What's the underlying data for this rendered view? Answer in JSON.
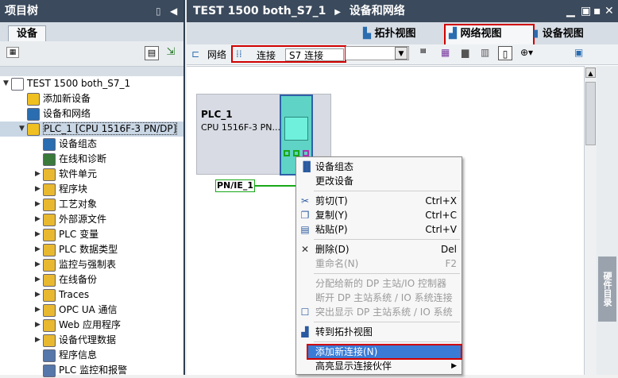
{
  "left_panel": {
    "title": "项目树",
    "tab": "设备",
    "tree": [
      {
        "label": "TEST 1500 both_S7_1",
        "indent": 0,
        "expanded": true,
        "icon": "project-icon"
      },
      {
        "label": "添加新设备",
        "indent": 1,
        "icon": "add-device-icon"
      },
      {
        "label": "设备和网络",
        "indent": 1,
        "icon": "network-icon"
      },
      {
        "label": "PLC_1 [CPU 1516F-3 PN/DP]",
        "indent": 1,
        "expanded": true,
        "icon": "plc-icon",
        "selected": true
      },
      {
        "label": "设备组态",
        "indent": 2,
        "icon": "device-config-icon"
      },
      {
        "label": "在线和诊断",
        "indent": 2,
        "icon": "online-diag-icon"
      },
      {
        "label": "软件单元",
        "indent": 2,
        "collapsed": true,
        "icon": "folder-icon"
      },
      {
        "label": "程序块",
        "indent": 2,
        "collapsed": true,
        "icon": "folder-icon"
      },
      {
        "label": "工艺对象",
        "indent": 2,
        "collapsed": true,
        "icon": "folder-icon"
      },
      {
        "label": "外部源文件",
        "indent": 2,
        "collapsed": true,
        "icon": "folder-icon"
      },
      {
        "label": "PLC 变量",
        "indent": 2,
        "collapsed": true,
        "icon": "folder-icon"
      },
      {
        "label": "PLC 数据类型",
        "indent": 2,
        "collapsed": true,
        "icon": "folder-icon"
      },
      {
        "label": "监控与强制表",
        "indent": 2,
        "collapsed": true,
        "icon": "folder-icon"
      },
      {
        "label": "在线备份",
        "indent": 2,
        "collapsed": true,
        "icon": "folder-icon"
      },
      {
        "label": "Traces",
        "indent": 2,
        "collapsed": true,
        "icon": "folder-icon"
      },
      {
        "label": "OPC UA 通信",
        "indent": 2,
        "collapsed": true,
        "icon": "folder-icon"
      },
      {
        "label": "Web 应用程序",
        "indent": 2,
        "collapsed": true,
        "icon": "folder-icon"
      },
      {
        "label": "设备代理数据",
        "indent": 2,
        "collapsed": true,
        "icon": "folder-icon"
      },
      {
        "label": "程序信息",
        "indent": 2,
        "icon": "info-icon"
      },
      {
        "label": "PLC 监控和报警",
        "indent": 2,
        "icon": "alarm-icon"
      }
    ]
  },
  "right_panel": {
    "breadcrumb": [
      "TEST 1500 both_S7_1",
      "设备和网络"
    ],
    "view_tabs": [
      "拓扑视图",
      "网络视图",
      "设备视图"
    ],
    "toolbar": {
      "network_label": "网络",
      "connect_label": "连接",
      "connection_type": "S7 连接"
    },
    "side_tab": "硬件目录",
    "device": {
      "name": "PLC_1",
      "type": "CPU 1516F-3 PN...",
      "port_label": "PN/IE_1"
    },
    "context_menu": {
      "items": [
        {
          "label": "设备组态",
          "icon": "device-config-icon"
        },
        {
          "label": "更改设备"
        },
        {
          "sep": true
        },
        {
          "label": "剪切(T)",
          "shortcut": "Ctrl+X",
          "icon": "scissors-icon"
        },
        {
          "label": "复制(Y)",
          "shortcut": "Ctrl+C",
          "icon": "copy-icon"
        },
        {
          "label": "粘贴(P)",
          "shortcut": "Ctrl+V",
          "icon": "paste-icon"
        },
        {
          "sep": true
        },
        {
          "label": "删除(D)",
          "shortcut": "Del",
          "icon": "delete-icon"
        },
        {
          "label": "重命名(N)",
          "shortcut": "F2",
          "disabled": true
        },
        {
          "sep": true
        },
        {
          "label": "分配给新的 DP 主站/IO 控制器",
          "disabled": true
        },
        {
          "label": "断开 DP 主站系统 / IO 系统连接",
          "disabled": true
        },
        {
          "label": "突出显示 DP 主站系统 / IO 系统",
          "disabled": true,
          "icon": "checkbox-icon"
        },
        {
          "sep": true
        },
        {
          "label": "转到拓扑视图",
          "icon": "topology-icon"
        },
        {
          "sep": true
        },
        {
          "label": "添加新连接(N)",
          "highlighted": true
        },
        {
          "label": "高亮显示连接伙伴",
          "submenu": true
        }
      ]
    }
  }
}
